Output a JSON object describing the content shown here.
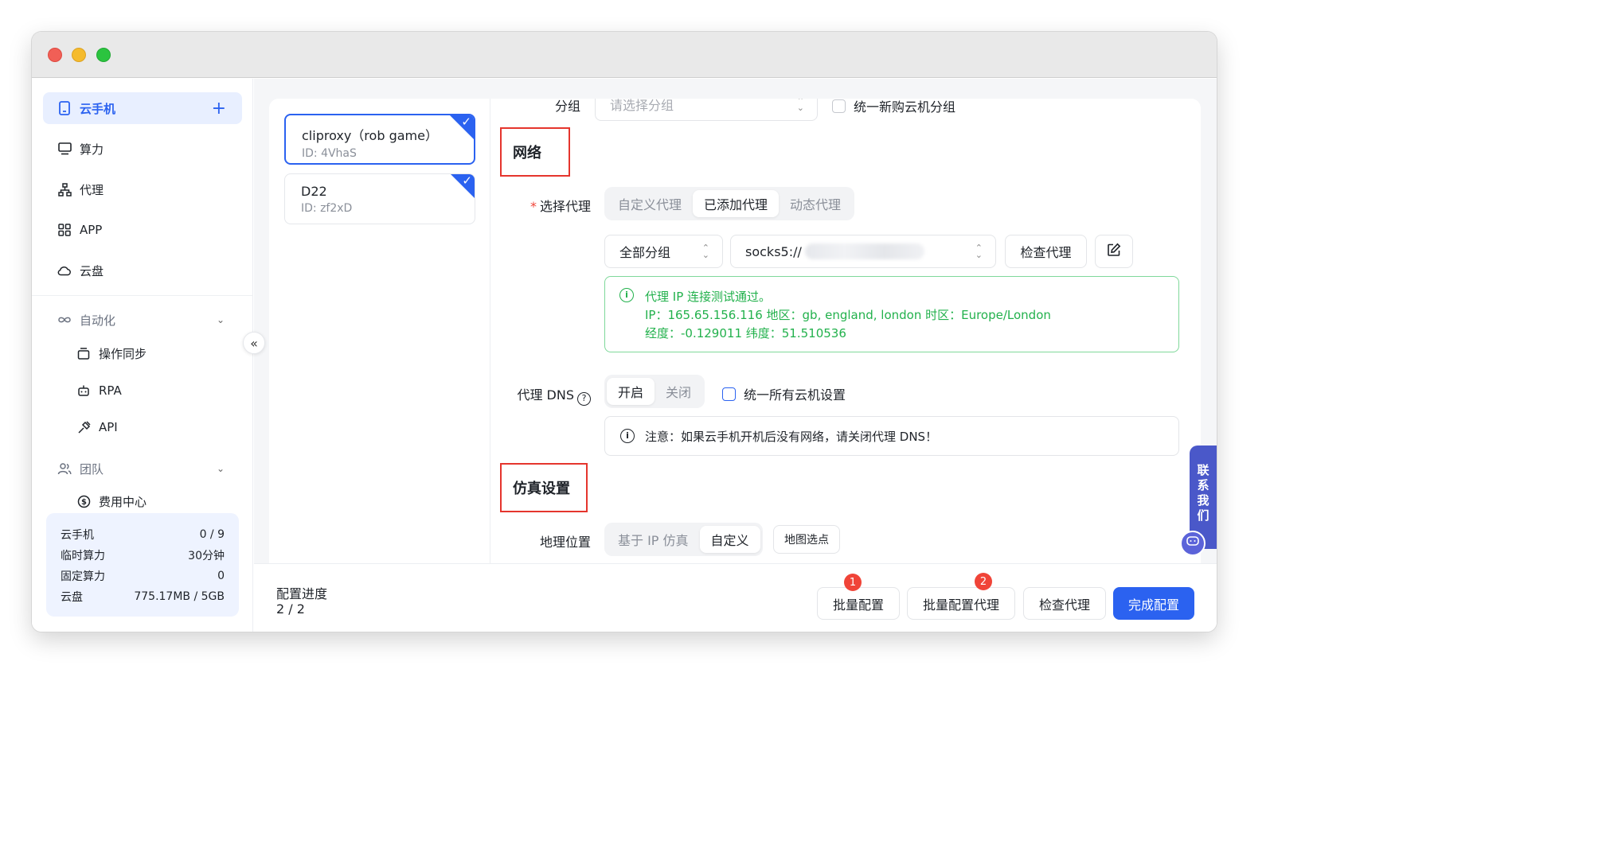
{
  "sidebar": {
    "phone": "云手机",
    "compute": "算力",
    "proxy": "代理",
    "app": "APP",
    "cloud_disk": "云盘",
    "automation": "自动化",
    "op_sync": "操作同步",
    "rpa": "RPA",
    "api": "API",
    "team": "团队",
    "billing": "费用中心"
  },
  "stats": [
    {
      "label": "云手机",
      "value": "0 / 9"
    },
    {
      "label": "临时算力",
      "value": "30分钟"
    },
    {
      "label": "固定算力",
      "value": "0"
    },
    {
      "label": "云盘",
      "value": "775.17MB / 5GB"
    }
  ],
  "devices": [
    {
      "name": "cliproxy（rob game）",
      "id": "ID: 4VhaS"
    },
    {
      "name": "D22",
      "id": "ID: zf2xD"
    }
  ],
  "form": {
    "group_label": "分组",
    "group_placeholder": "请选择分组",
    "unify_group": "统一新购云机分组",
    "network_title": "网络",
    "select_proxy_label": "选择代理",
    "proxy_tabs": [
      "自定义代理",
      "已添加代理",
      "动态代理"
    ],
    "all_groups": "全部分组",
    "proxy_value": "socks5://",
    "check_proxy": "检查代理",
    "ok_line1": "代理 IP 连接测试通过。",
    "ok_line2": "IP：165.65.156.116  地区：gb, england, london  时区：Europe/London",
    "ok_line3": "经度：-0.129011  纬度：51.510536",
    "dns_label": "代理 DNS",
    "dns_on": "开启",
    "dns_off": "关闭",
    "unify_all": "统一所有云机设置",
    "dns_note": "注意：如果云手机开机后没有网络，请关闭代理 DNS！",
    "sim_title": "仿真设置",
    "geo_label": "地理位置",
    "geo_ip": "基于 IP 仿真",
    "geo_custom": "自定义",
    "map_pick": "地图选点"
  },
  "footer": {
    "progress_label": "配置进度",
    "progress_value": "2 / 2",
    "batch_config": "批量配置",
    "batch_proxy": "批量配置代理",
    "check_proxy": "检查代理",
    "finish": "完成配置",
    "badge1": "1",
    "badge2": "2"
  },
  "contact": [
    "联",
    "系",
    "我",
    "们"
  ]
}
